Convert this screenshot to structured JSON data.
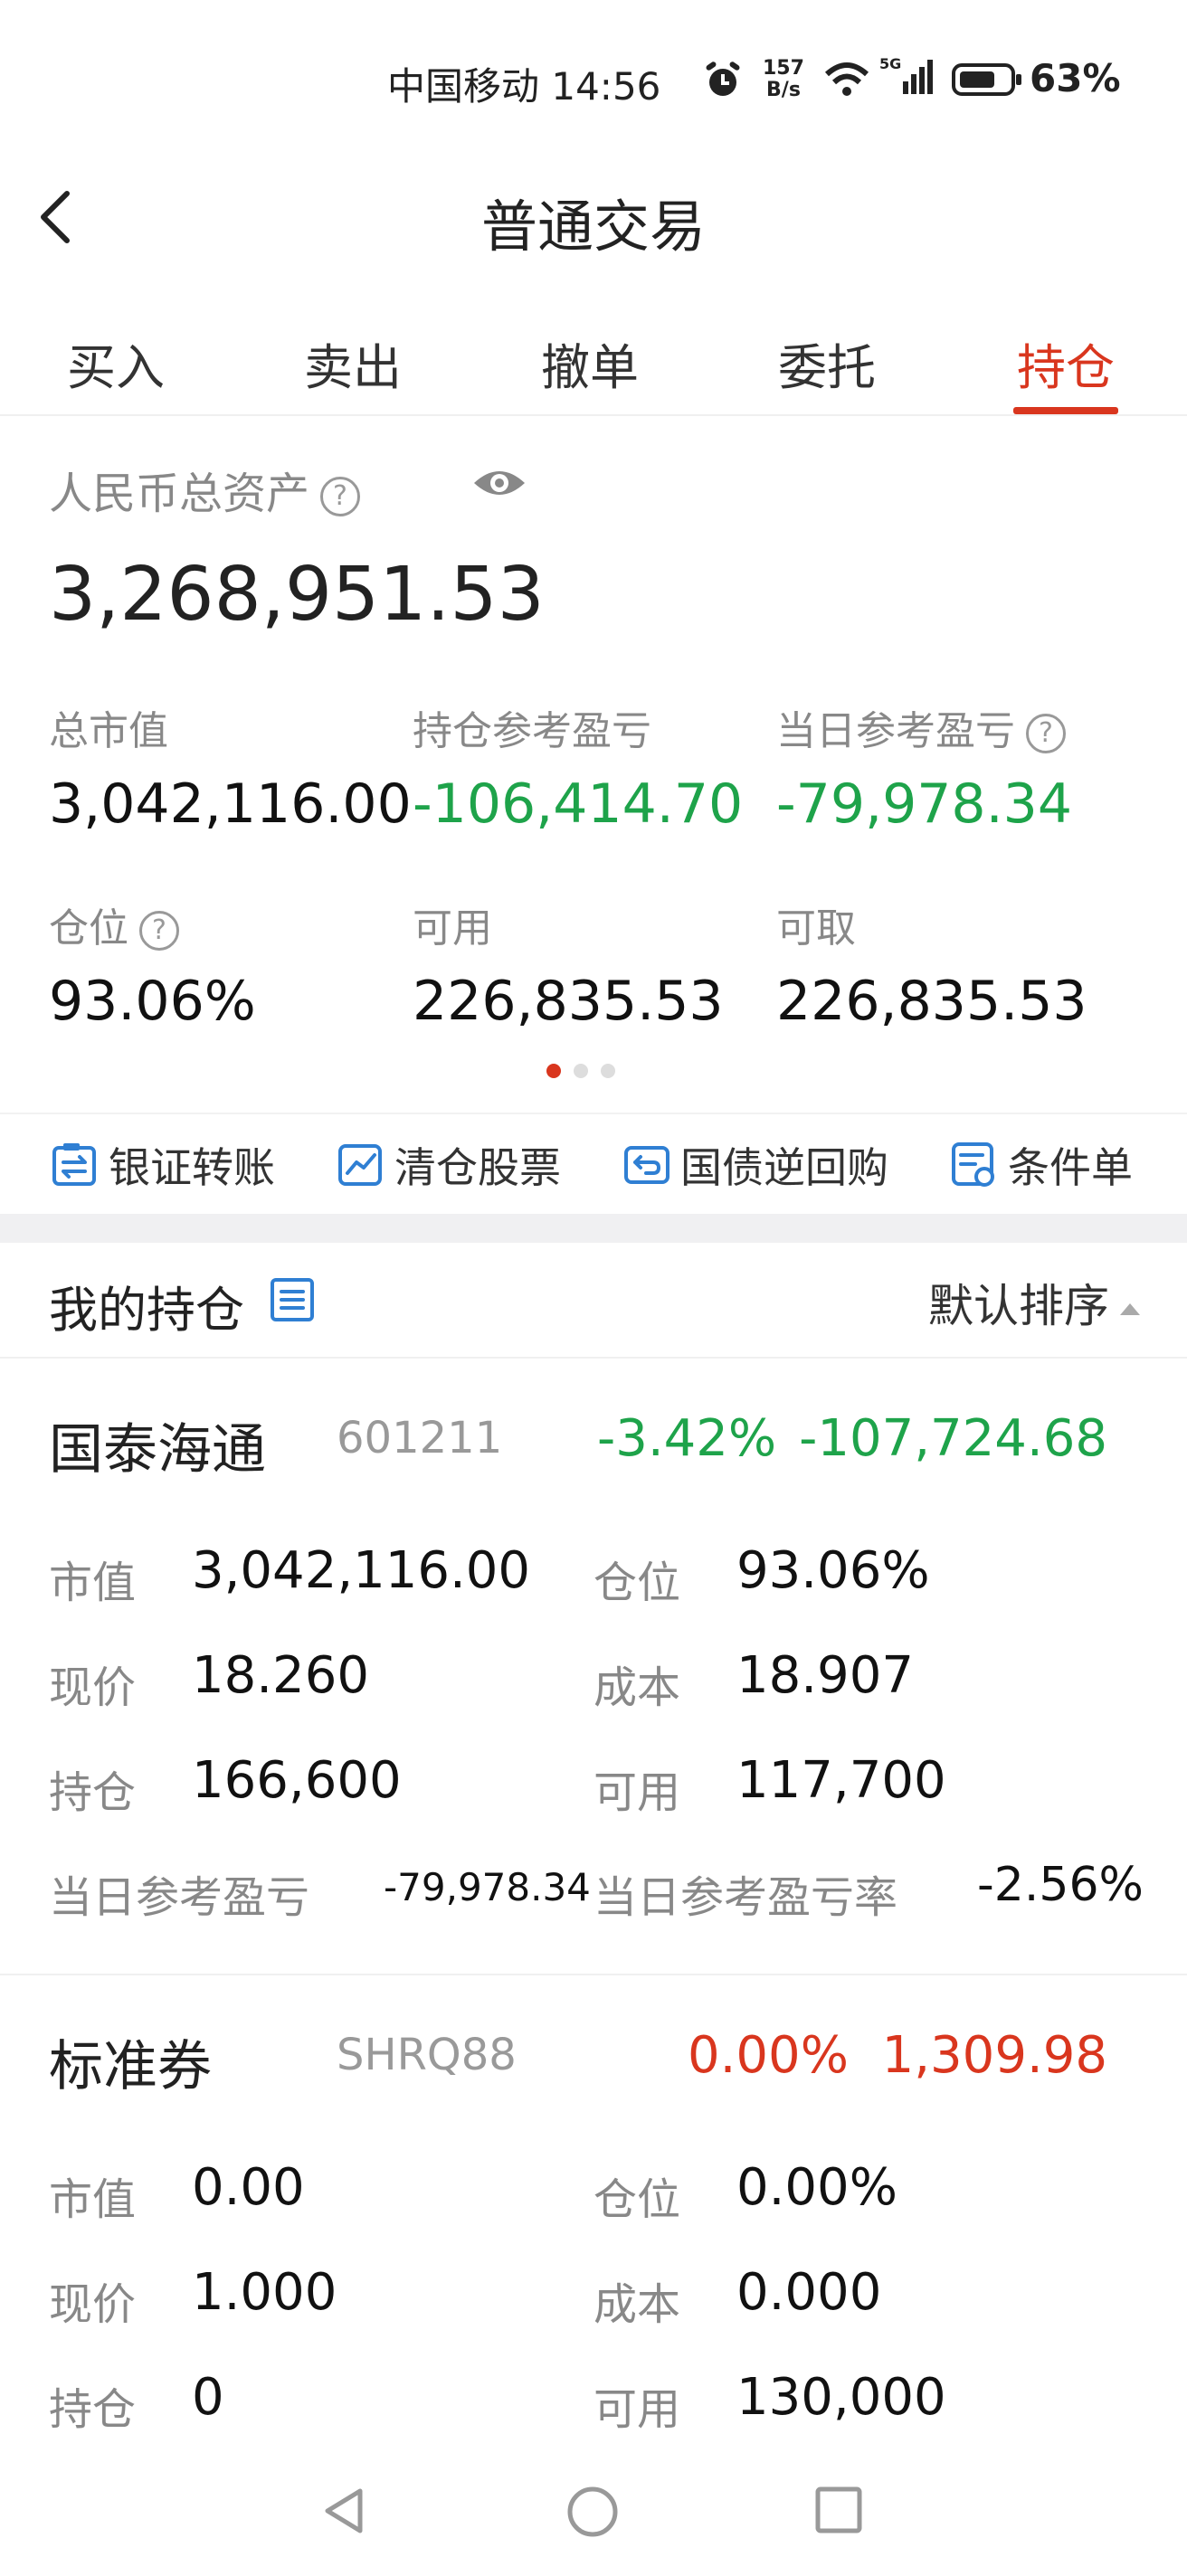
{
  "status_bar": {
    "carrier_time": "中国移动 14:56",
    "net_speed_top": "157",
    "net_speed_bottom": "B/s",
    "battery": "63%"
  },
  "header": {
    "title": "普通交易"
  },
  "tabs": [
    {
      "label": "买入"
    },
    {
      "label": "卖出"
    },
    {
      "label": "撤单"
    },
    {
      "label": "委托"
    },
    {
      "label": "持仓",
      "active": true
    }
  ],
  "assets": {
    "total_label": "人民币总资产",
    "total_value": "3,268,951.53",
    "fields": [
      {
        "label": "总市值",
        "value": "3,042,116.00"
      },
      {
        "label": "持仓参考盈亏",
        "value": "-106,414.70"
      },
      {
        "label": "当日参考盈亏",
        "value": "-79,978.34"
      },
      {
        "label": "仓位",
        "value": "93.06%"
      },
      {
        "label": "可用",
        "value": "226,835.53"
      },
      {
        "label": "可取",
        "value": "226,835.53"
      }
    ],
    "help_symbol": "?"
  },
  "actions": [
    {
      "label": "银证转账",
      "icon": "transfer-icon"
    },
    {
      "label": "清仓股票",
      "icon": "chart-icon"
    },
    {
      "label": "国债逆回购",
      "icon": "repo-icon"
    },
    {
      "label": "条件单",
      "icon": "condition-order-icon"
    }
  ],
  "holdings": {
    "title": "我的持仓",
    "sort_label": "默认排序",
    "items": [
      {
        "name": "国泰海通",
        "code": "601211",
        "change_pct": "-3.42%",
        "pnl": "-107,724.68",
        "market_value_label": "市值",
        "market_value": "3,042,116.00",
        "position_label": "仓位",
        "position": "93.06%",
        "price_label": "现价",
        "price": "18.260",
        "cost_label": "成本",
        "cost": "18.907",
        "hold_label": "持仓",
        "hold": "166,600",
        "available_label": "可用",
        "available": "117,700",
        "day_pnl_label": "当日参考盈亏",
        "day_pnl": "-79,978.34",
        "day_pnl_rate_label": "当日参考盈亏率",
        "day_pnl_rate": "-2.56%"
      },
      {
        "name": "标准券",
        "code": "SHRQ88",
        "change_pct": "0.00%",
        "pnl": "1,309.98",
        "market_value_label": "市值",
        "market_value": "0.00",
        "position_label": "仓位",
        "position": "0.00%",
        "price_label": "现价",
        "price": "1.000",
        "cost_label": "成本",
        "cost": "0.000",
        "hold_label": "持仓",
        "hold": "0",
        "available_label": "可用",
        "available": "130,000"
      }
    ]
  },
  "colors": {
    "accent": "#d9361e",
    "loss": "#1ea34a",
    "gain": "#d9361e",
    "icon_blue": "#2f7fd3"
  }
}
